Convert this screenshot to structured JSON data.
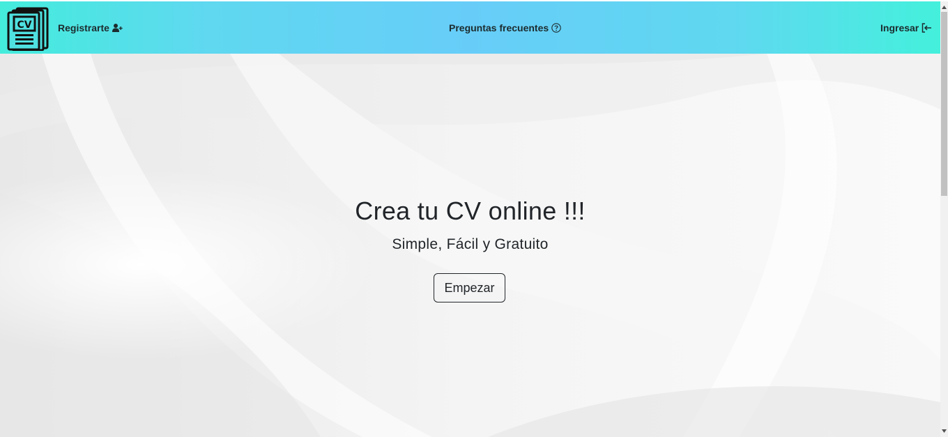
{
  "app": {
    "logo_icon": "cv-document-logo-icon",
    "logo_text": "CV"
  },
  "nav": {
    "register_label": "Registrarte",
    "register_icon": "user-plus-icon",
    "faq_label": "Preguntas frecuentes",
    "faq_icon": "question-circle-icon",
    "login_label": "Ingresar",
    "login_icon": "sign-in-icon"
  },
  "hero": {
    "title": "Crea tu CV online !!!",
    "subtitle": "Simple, Fácil y Gratuito",
    "cta_label": "Empezar"
  },
  "colors": {
    "navbar_gradient_start": "#44ecdc",
    "navbar_gradient_mid": "#67cdf8",
    "text": "#212529",
    "hero_background": "#f1f1f1"
  }
}
